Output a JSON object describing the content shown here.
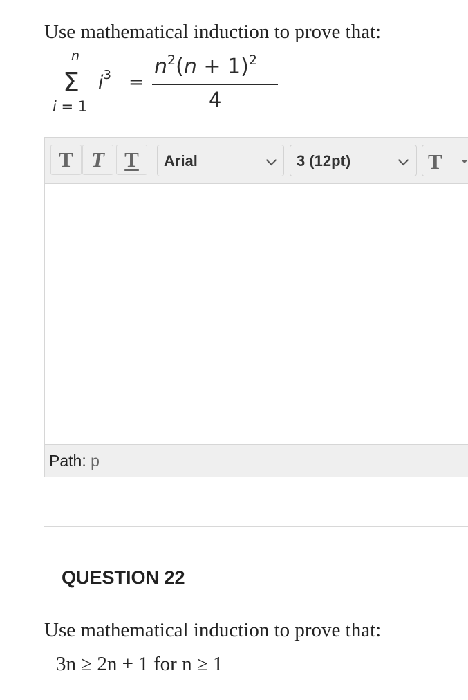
{
  "question21": {
    "prompt": "Use mathematical induction to prove that:",
    "formula": {
      "upper_limit": "n",
      "sigma": "Σ",
      "term": "i",
      "term_exponent": "3",
      "lower_var": "i",
      "lower_rest": " = 1",
      "equals": "=",
      "numerator_n": "n",
      "numerator_n_exp": "2",
      "numerator_open": "(",
      "numerator_n2": "n",
      "numerator_plus": " + 1)",
      "numerator_exp2": "2",
      "denominator": "4"
    }
  },
  "editor": {
    "toolbar": {
      "bold_label": "T",
      "italic_label": "T",
      "underline_label": "T",
      "font_family_value": "Arial",
      "font_size_value": "3 (12pt)",
      "text_color_label": "T"
    },
    "status": {
      "path_label": "Path:",
      "path_value": "p"
    }
  },
  "question22": {
    "title": "QUESTION 22",
    "prompt": "Use mathematical induction to prove that:",
    "statement": "3n ≥ 2n + 1 for n ≥ 1"
  }
}
